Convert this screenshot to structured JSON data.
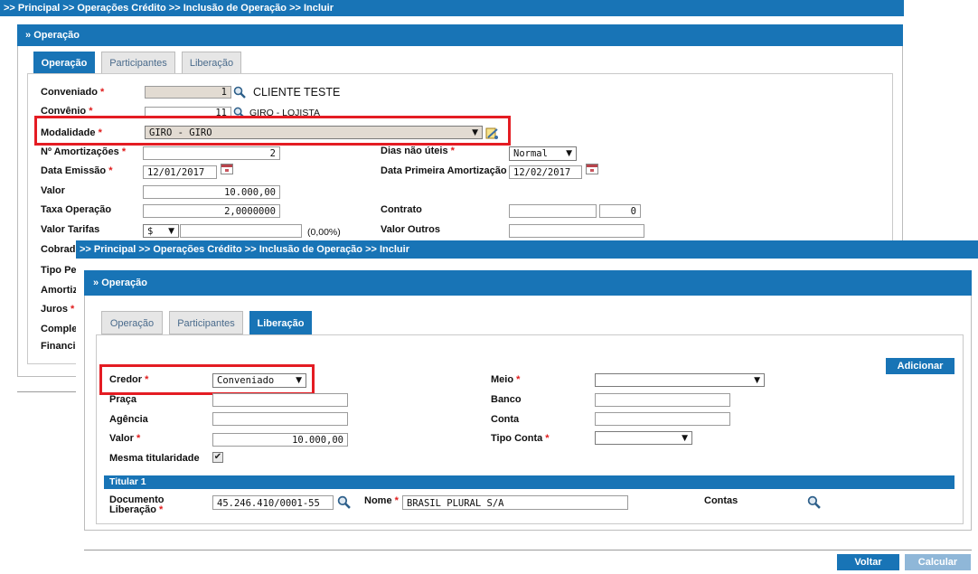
{
  "back": {
    "breadcrumb": ">> Principal >> Operações Crédito >> Inclusão de Operação >> Incluir",
    "panel_title": "Operação",
    "tabs": [
      {
        "label": "Operação",
        "active": true
      },
      {
        "label": "Participantes",
        "active": false
      },
      {
        "label": "Liberação",
        "active": false
      }
    ],
    "conveniado": {
      "label": "Conveniado",
      "value": "1",
      "name": "CLIENTE TESTE"
    },
    "convenio": {
      "label": "Convênio",
      "value": "11",
      "name": "GIRO - LOJISTA"
    },
    "modalidade": {
      "label": "Modalidade",
      "value": "GIRO - GIRO"
    },
    "amortizacoes": {
      "label": "Nº Amortizações",
      "value": "2"
    },
    "dias_nao_uteis": {
      "label": "Dias não úteis",
      "value": "Normal"
    },
    "data_emissao": {
      "label": "Data Emissão",
      "value": "12/01/2017"
    },
    "data_primeira": {
      "label": "Data Primeira Amortização",
      "value": "12/02/2017"
    },
    "valor": {
      "label": "Valor",
      "value": "10.000,00"
    },
    "taxa": {
      "label": "Taxa Operação",
      "value": "2,0000000"
    },
    "contrato": {
      "label": "Contrato",
      "value": "0"
    },
    "tarifas": {
      "label": "Valor Tarifas",
      "currency": "$",
      "percent": "(0,00%)"
    },
    "valor_outros": {
      "label": "Valor Outros"
    },
    "side_labels": [
      "Cobrad",
      "Tipo Pe",
      "Amortiz",
      "Juros",
      "Comple",
      "Financi"
    ]
  },
  "front": {
    "breadcrumb": ">> Principal >> Operações Crédito >> Inclusão de Operação >> Incluir",
    "panel_title": "Operação",
    "tabs": [
      {
        "label": "Operação",
        "active": false
      },
      {
        "label": "Participantes",
        "active": false
      },
      {
        "label": "Liberação",
        "active": true
      }
    ],
    "add_button": "Adicionar",
    "credor": {
      "label": "Credor",
      "value": "Conveniado"
    },
    "praca": {
      "label": "Praça",
      "value": ""
    },
    "agencia": {
      "label": "Agência",
      "value": ""
    },
    "valor": {
      "label": "Valor",
      "value": "10.000,00"
    },
    "mesma_titularidade": {
      "label": "Mesma titularidade",
      "checked": true
    },
    "meio": {
      "label": "Meio",
      "value": ""
    },
    "banco": {
      "label": "Banco",
      "value": ""
    },
    "conta": {
      "label": "Conta",
      "value": ""
    },
    "tipo_conta": {
      "label": "Tipo Conta",
      "value": ""
    },
    "titular": {
      "title": "Titular 1",
      "documento_label_1": "Documento",
      "documento_label_2": "Liberação",
      "documento_value": "45.246.410/0001-55",
      "nome_label": "Nome",
      "nome_value": "BRASIL PLURAL S/A",
      "contas_label": "Contas"
    }
  },
  "footer": {
    "voltar": "Voltar",
    "calcular": "Calcular"
  },
  "colors": {
    "brand_blue": "#1874b6",
    "highlight_red": "#e41c23",
    "required_red": "#e01c1c",
    "disabled_button": "#8fb7d8"
  },
  "icons": [
    "search-icon",
    "calendar-icon",
    "edit-icon",
    "chevron-down-icon",
    "checkbox-checked-icon"
  ]
}
